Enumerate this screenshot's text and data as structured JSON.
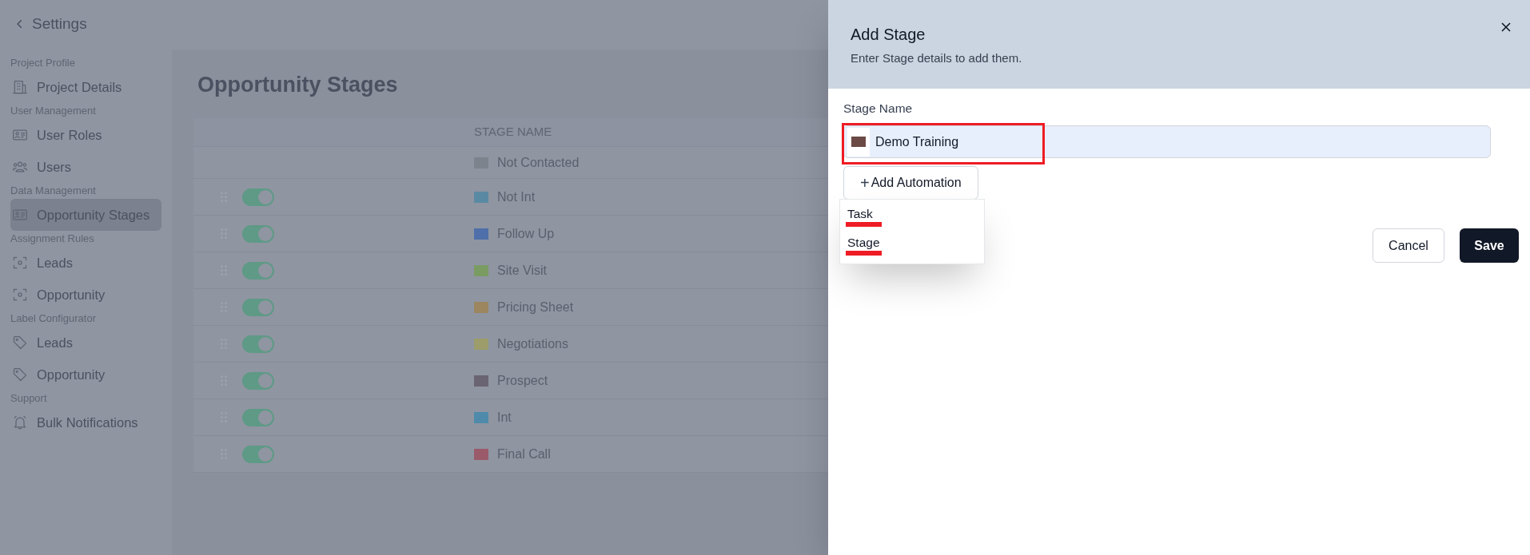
{
  "sidebar": {
    "back_label": "Settings",
    "sections": [
      {
        "label": "Project Profile",
        "items": [
          {
            "label": "Project Details",
            "selected": false
          }
        ]
      },
      {
        "label": "User Management",
        "items": [
          {
            "label": "User Roles",
            "selected": false
          },
          {
            "label": "Users",
            "selected": false
          }
        ]
      },
      {
        "label": "Data Management",
        "items": [
          {
            "label": "Opportunity Stages",
            "selected": true
          }
        ]
      },
      {
        "label": "Assignment Rules",
        "items": [
          {
            "label": "Leads",
            "selected": false
          },
          {
            "label": "Opportunity",
            "selected": false
          }
        ]
      },
      {
        "label": "Label Configurator",
        "items": [
          {
            "label": "Leads",
            "selected": false
          },
          {
            "label": "Opportunity",
            "selected": false
          }
        ]
      },
      {
        "label": "Support",
        "items": [
          {
            "label": "Bulk Notifications",
            "selected": false
          }
        ]
      }
    ]
  },
  "page_title": "Opportunity Stages",
  "table": {
    "columns": [
      "STAGE NAME"
    ],
    "rows": [
      {
        "kind": "fixed",
        "name": "Not Contacted",
        "color": "#7c838d"
      },
      {
        "kind": "toggleable",
        "on": true,
        "name": "Not Int",
        "color": "#5a8aa3"
      },
      {
        "kind": "toggleable",
        "on": true,
        "name": "Follow Up",
        "color": "#4e6fa9"
      },
      {
        "kind": "toggleable",
        "on": true,
        "name": "Site Visit",
        "color": "#7a9c63"
      },
      {
        "kind": "toggleable",
        "on": true,
        "name": "Pricing Sheet",
        "color": "#9b8660"
      },
      {
        "kind": "toggleable",
        "on": true,
        "name": "Negotiations",
        "color": "#9c9d6b"
      },
      {
        "kind": "toggleable",
        "on": true,
        "name": "Prospect",
        "color": "#6a6472"
      },
      {
        "kind": "toggleable",
        "on": true,
        "name": "Int",
        "color": "#4f8aab"
      },
      {
        "kind": "toggleable",
        "on": true,
        "name": "Final Call",
        "color": "#9b5a6a"
      }
    ]
  },
  "drawer": {
    "title": "Add Stage",
    "subtitle": "Enter Stage details to add them.",
    "field": {
      "label": "Stage Name",
      "value": "Demo Training",
      "color": "#6b4a45"
    },
    "add_button": "Add Automation",
    "add_icon": "+",
    "menu_items": [
      {
        "label": "Task"
      },
      {
        "label": "Stage"
      }
    ],
    "buttons": [
      {
        "kind": "secondary",
        "label": "Cancel"
      },
      {
        "kind": "primary",
        "label": "Save"
      }
    ]
  }
}
